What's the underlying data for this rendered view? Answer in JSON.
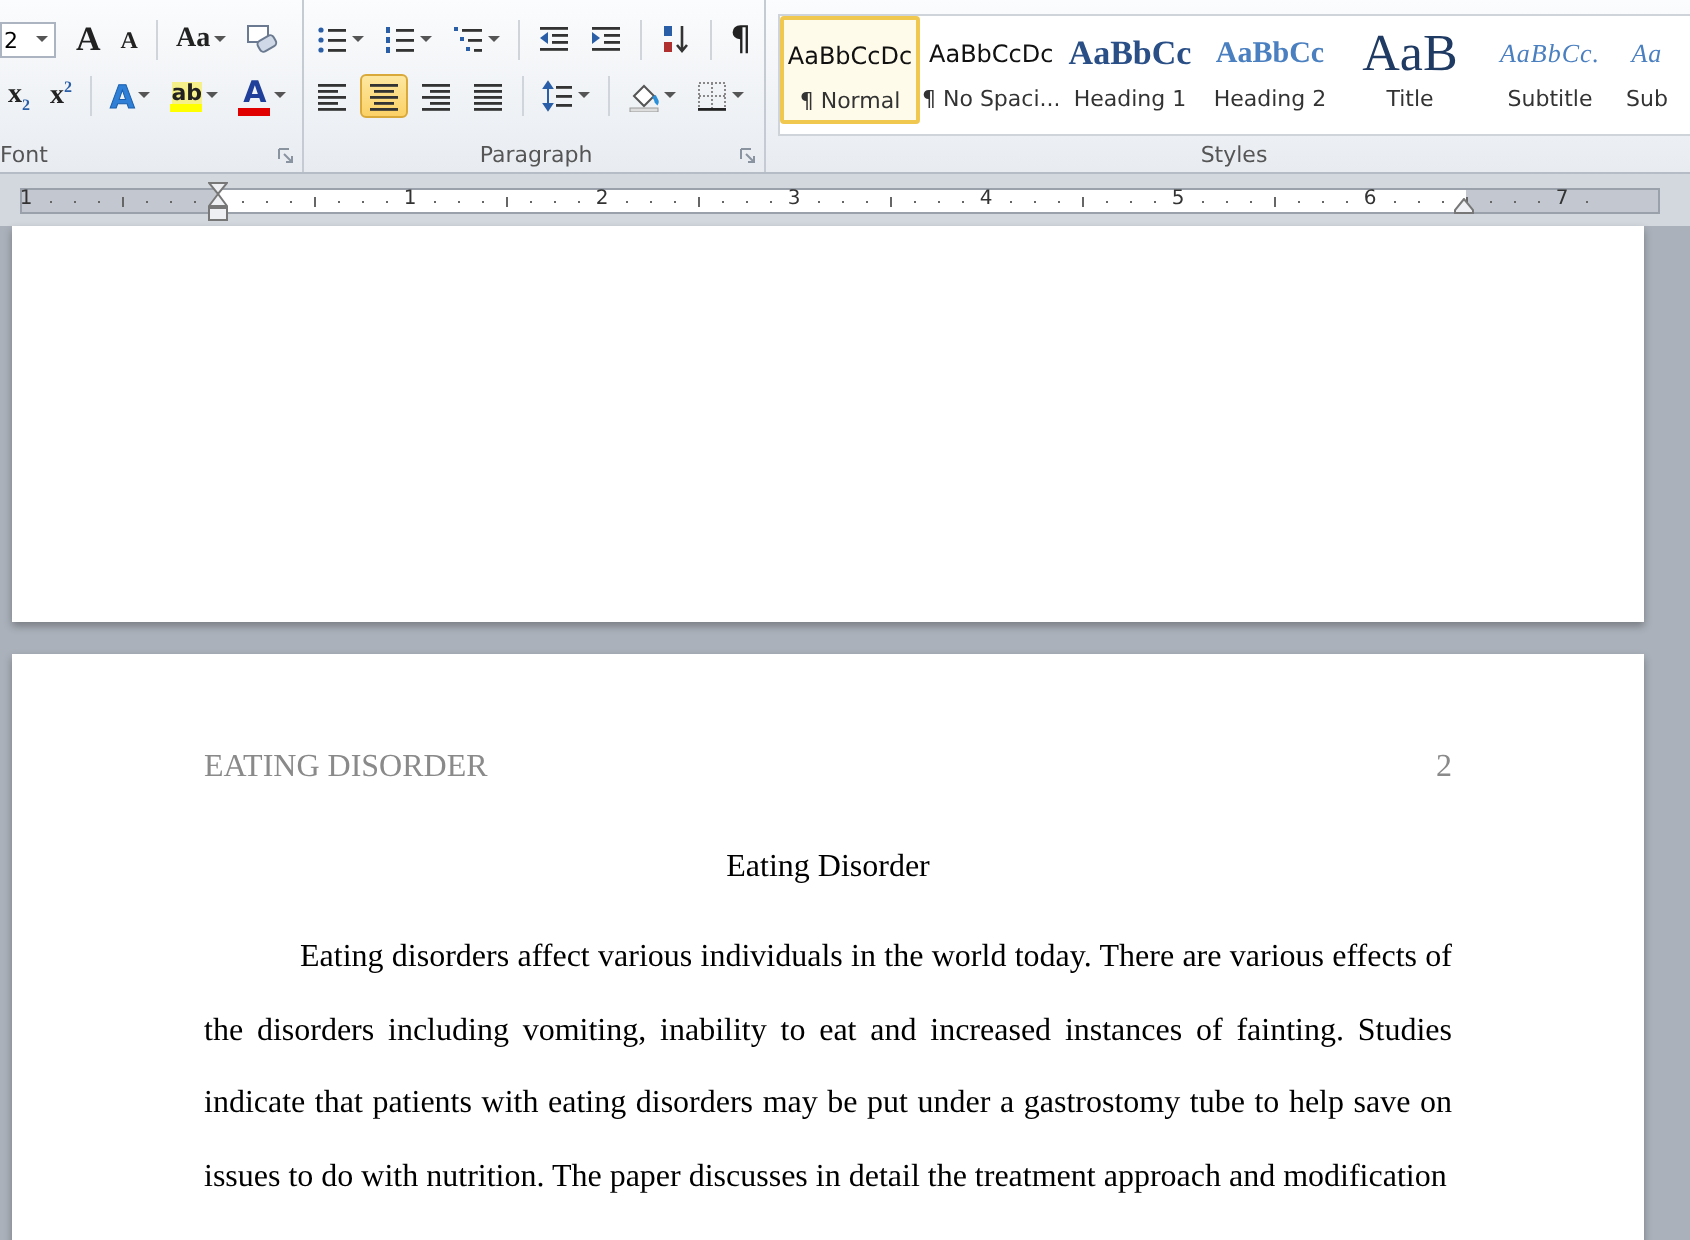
{
  "ribbon": {
    "font_group": {
      "label": "Font",
      "font_size": "2",
      "row1": [
        {
          "kind": "grow",
          "glyph": "A",
          "caret": false
        },
        {
          "kind": "shrink",
          "glyph": "A",
          "caret": false
        },
        {
          "kind": "case",
          "glyph": "Aa",
          "caret": true
        },
        {
          "kind": "clear",
          "caret": false
        }
      ],
      "row2": [
        {
          "kind": "subscript",
          "glyph": "x",
          "script": "2",
          "caret": false
        },
        {
          "kind": "superscript",
          "glyph": "x",
          "script": "2",
          "caret": false
        },
        {
          "kind": "effects",
          "glyph": "A",
          "caret": true
        },
        {
          "kind": "highlight",
          "glyph": "ab",
          "caret": true
        },
        {
          "kind": "fontcolor",
          "glyph": "A",
          "caret": true
        }
      ]
    },
    "paragraph_group": {
      "label": "Paragraph",
      "row1": [
        {
          "kind": "bullets",
          "caret": true
        },
        {
          "kind": "numbering",
          "caret": true
        },
        {
          "kind": "multilevel",
          "caret": true
        },
        {
          "kind": "outdent",
          "caret": false
        },
        {
          "kind": "indent",
          "caret": false
        },
        {
          "kind": "sort",
          "caret": false
        },
        {
          "kind": "marks",
          "glyph": "¶",
          "caret": false
        }
      ],
      "row2": [
        {
          "kind": "align-left",
          "selected": false,
          "caret": false
        },
        {
          "kind": "align-center",
          "selected": true,
          "caret": false
        },
        {
          "kind": "align-right",
          "selected": false,
          "caret": false
        },
        {
          "kind": "justify",
          "selected": false,
          "caret": false
        },
        {
          "kind": "spacing",
          "caret": true
        },
        {
          "kind": "shading",
          "caret": true
        },
        {
          "kind": "borders",
          "caret": true
        }
      ]
    },
    "styles_group": {
      "label": "Styles",
      "items": [
        {
          "preview": "AaBbCcDc",
          "label": "¶ Normal",
          "kind": "normal",
          "selected": true
        },
        {
          "preview": "AaBbCcDc",
          "label": "¶ No Spaci...",
          "kind": "normal",
          "selected": false
        },
        {
          "preview": "AaBbCc",
          "label": "Heading 1",
          "kind": "heading1",
          "selected": false
        },
        {
          "preview": "AaBbCc",
          "label": "Heading 2",
          "kind": "heading2",
          "selected": false
        },
        {
          "preview": "AaB",
          "label": "Title",
          "kind": "title",
          "selected": false
        },
        {
          "preview": "AaBbCc.",
          "label": "Subtitle",
          "kind": "subtitle",
          "selected": false
        },
        {
          "preview": "Aa",
          "label": "Sub",
          "kind": "subtitle",
          "selected": false
        }
      ]
    }
  },
  "ruler": {
    "numbers": [
      "1",
      "1",
      "2",
      "3",
      "4",
      "5",
      "6",
      "7"
    ]
  },
  "page": {
    "header": "EATING DISORDER",
    "page_number": "2",
    "title": "Eating Disorder",
    "paragraph": "Eating disorders affect various individuals in the world today. There are various effects of the disorders including vomiting, inability to eat and increased instances of fainting. Studies indicate that patients with eating disorders may be put under a gastrostomy tube to help save on issues to do with nutrition. The paper discusses in detail the treatment approach and modification"
  }
}
